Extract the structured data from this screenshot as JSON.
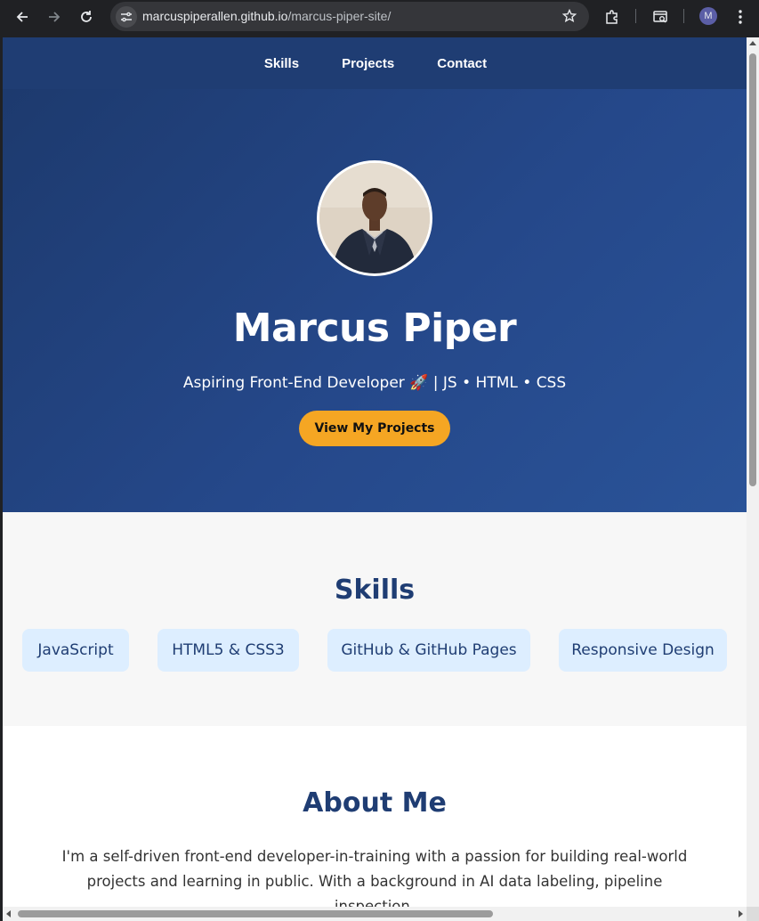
{
  "browser": {
    "url_host": "marcuspiperallen.github.io",
    "url_path": "/marcus-piper-site/",
    "profile_initial": "M"
  },
  "nav": {
    "items": [
      {
        "label": "Skills"
      },
      {
        "label": "Projects"
      },
      {
        "label": "Contact"
      }
    ]
  },
  "hero": {
    "name": "Marcus Piper",
    "tagline": "Aspiring Front-End Developer 🚀 | JS • HTML • CSS",
    "cta_label": "View My Projects"
  },
  "skills": {
    "title": "Skills",
    "items": [
      {
        "label": "JavaScript"
      },
      {
        "label": "HTML5 & CSS3"
      },
      {
        "label": "GitHub & GitHub Pages"
      },
      {
        "label": "Responsive Design"
      }
    ]
  },
  "about": {
    "title": "About Me",
    "text": "I'm a self-driven front-end developer-in-training with a passion for building real-world projects and learning in public. With a background in AI data labeling, pipeline inspection,"
  },
  "colors": {
    "nav_bg": "#1f3d73",
    "accent": "#f5a623",
    "heading": "#1f3d73",
    "pill_bg": "#ddeeff"
  }
}
